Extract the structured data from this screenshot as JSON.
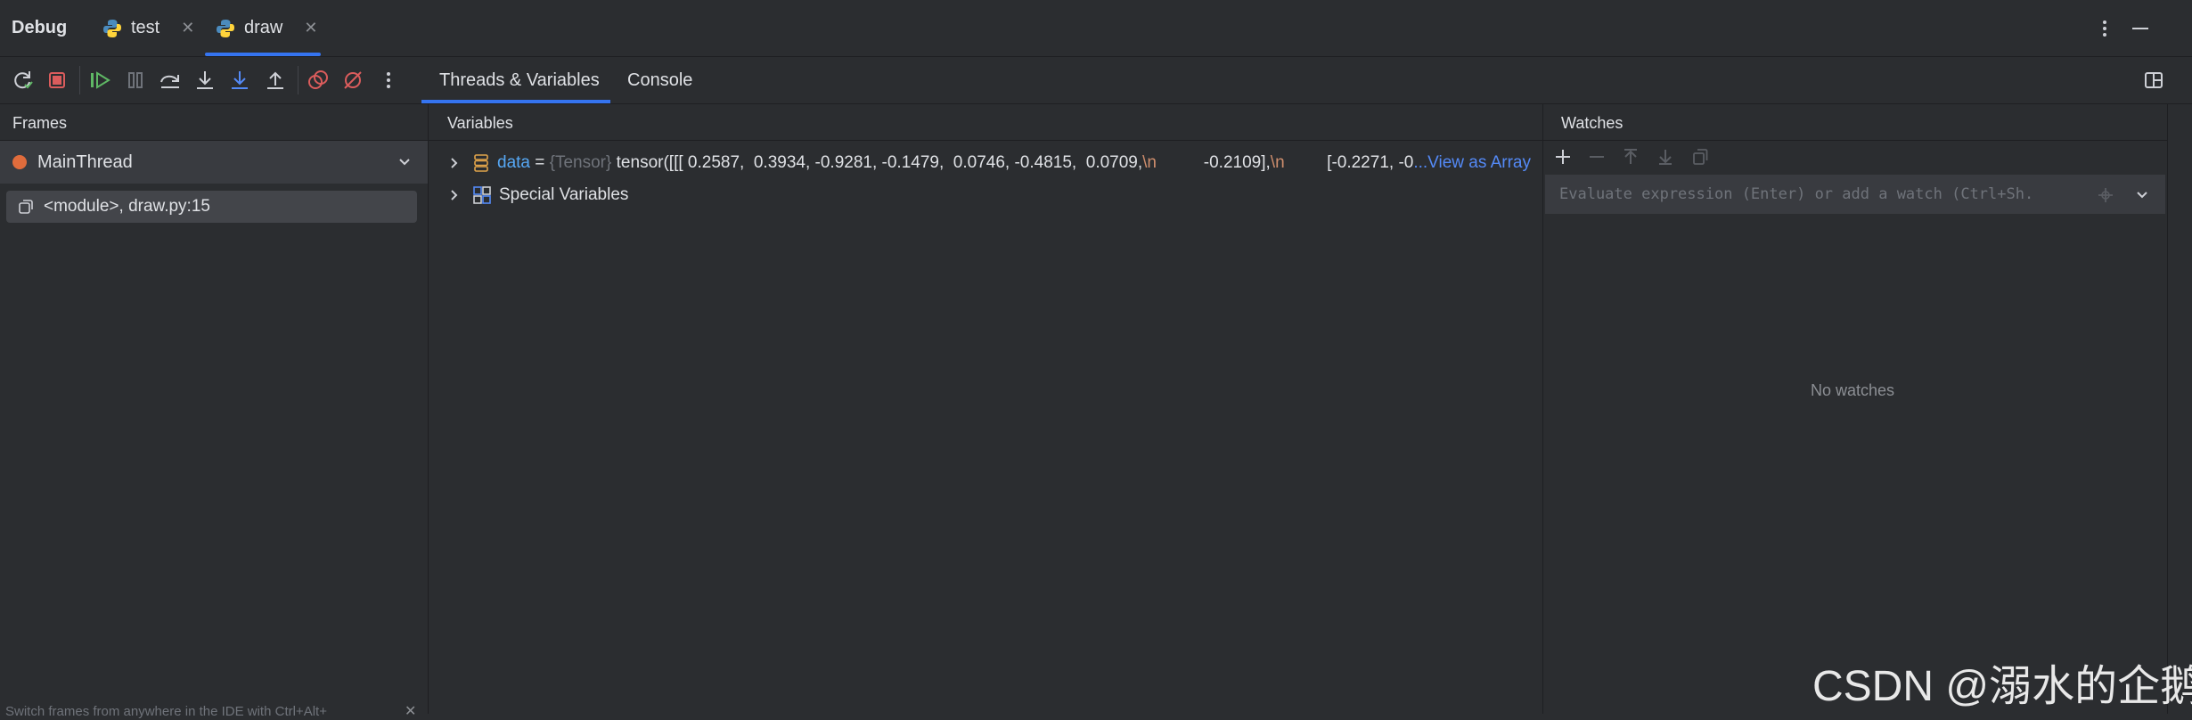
{
  "titlebar": {
    "debug_label": "Debug",
    "tabs": [
      {
        "label": "test",
        "active": false
      },
      {
        "label": "draw",
        "active": true
      }
    ]
  },
  "toolbar": {
    "icons": [
      "rerun-icon",
      "stop-icon",
      "resume-icon",
      "pause-icon",
      "step-over-icon",
      "step-into-icon",
      "step-into-my-code-icon",
      "step-out-icon",
      "view-breakpoints-icon",
      "mute-breakpoints-icon",
      "more-icon"
    ],
    "main_tabs": [
      "Threads & Variables",
      "Console"
    ],
    "active_tab": "Threads & Variables"
  },
  "frames": {
    "title": "Frames",
    "thread": "MainThread",
    "frame": "<module>, draw.py:15",
    "hint": "Switch frames from anywhere in the IDE with Ctrl+Alt+"
  },
  "variables": {
    "title": "Variables",
    "rows": [
      {
        "name": "data",
        "eq": " = ",
        "type": "{Tensor}",
        "value_part1": " tensor([[[ 0.2587,  0.3934, -0.9281, -0.1479,  0.0746, -0.4815,  0.0709,",
        "nl1": "\\n",
        "value_part2": "          -0.2109],",
        "nl2": "\\n",
        "value_part3": "         [-0.2271, -0",
        "link": "...View as Array"
      },
      {
        "name": "Special Variables"
      }
    ]
  },
  "watches": {
    "title": "Watches",
    "placeholder": "Evaluate expression (Enter) or add a watch (Ctrl+Sh.",
    "empty_text": "No watches"
  },
  "watermark": "CSDN @溺水的企鹅",
  "colors": {
    "accent": "#3574f0",
    "var_name": "#56a8f5",
    "link": "#548af7",
    "newline": "#cf8e6d",
    "thread_dot": "#e06c3c",
    "stop": "#db5c5c",
    "resume": "#5fb865"
  }
}
